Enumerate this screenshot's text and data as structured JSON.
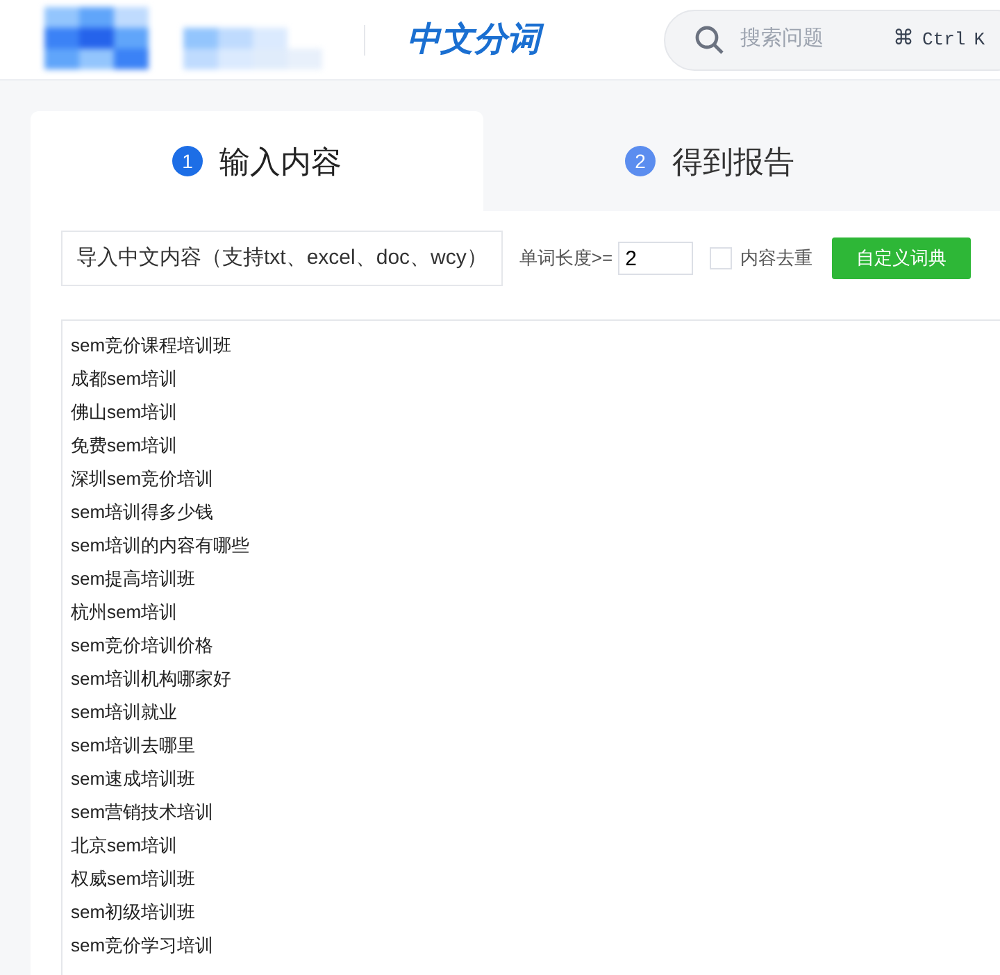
{
  "header": {
    "title": "中文分词",
    "search": {
      "placeholder": "搜索问题",
      "shortcut_symbol": "⌘",
      "shortcut_keys": [
        "Ctrl",
        "K"
      ]
    }
  },
  "tabs": [
    {
      "number": "1",
      "label": "输入内容",
      "selected": true
    },
    {
      "number": "2",
      "label": "得到报告",
      "selected": false
    }
  ],
  "toolbar": {
    "import_label": "导入中文内容（支持txt、excel、doc、wcy）",
    "length_label": "单词长度>=",
    "length_value": "2",
    "dedupe": {
      "label": "内容去重",
      "checked": false
    },
    "dictionary_button": "自定义词典"
  },
  "content_lines": [
    "sem竞价课程培训班",
    "成都sem培训",
    "佛山sem培训",
    "免费sem培训",
    "深圳sem竞价培训",
    "sem培训得多少钱",
    "sem培训的内容有哪些",
    "sem提高培训班",
    "杭州sem培训",
    "sem竞价培训价格",
    "sem培训机构哪家好",
    "sem培训就业",
    "sem培训去哪里",
    "sem速成培训班",
    "sem营销技术培训",
    "北京sem培训",
    "权威sem培训班",
    "sem初级培训班",
    "sem竞价学习培训"
  ]
}
